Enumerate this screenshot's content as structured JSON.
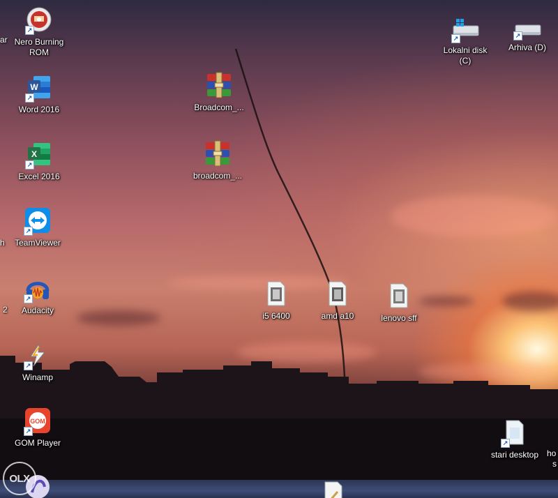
{
  "desktop": {
    "icons": [
      {
        "id": "nero",
        "label": "Nero Burning\nROM",
        "icon": "nero-burning-rom-icon",
        "shortcut": true
      },
      {
        "id": "word",
        "label": "Word 2016",
        "icon": "word-icon",
        "shortcut": true
      },
      {
        "id": "excel",
        "label": "Excel 2016",
        "icon": "excel-icon",
        "shortcut": true
      },
      {
        "id": "teamviewer",
        "label": "TeamViewer",
        "icon": "teamviewer-icon",
        "shortcut": true
      },
      {
        "id": "audacity",
        "label": "Audacity",
        "icon": "audacity-icon",
        "shortcut": true
      },
      {
        "id": "winamp",
        "label": "Winamp",
        "icon": "winamp-icon",
        "shortcut": true
      },
      {
        "id": "gom",
        "label": "GOM Player",
        "icon": "gom-player-icon",
        "shortcut": true
      },
      {
        "id": "broadcom1",
        "label": "Broadcom_...",
        "icon": "winrar-archive-icon",
        "shortcut": false
      },
      {
        "id": "broadcom2",
        "label": "broadcom_...",
        "icon": "winrar-archive-icon",
        "shortcut": false
      },
      {
        "id": "drive_c",
        "label": "Lokalni disk\n(C)",
        "icon": "local-disk-icon",
        "shortcut": true
      },
      {
        "id": "drive_d",
        "label": "Arhiva (D)",
        "icon": "drive-icon",
        "shortcut": true
      },
      {
        "id": "i5",
        "label": "i5 6400",
        "icon": "image-file-icon",
        "shortcut": false
      },
      {
        "id": "amd",
        "label": "amd a10",
        "icon": "image-file-icon",
        "shortcut": false
      },
      {
        "id": "lenovo",
        "label": "lenovo sff",
        "icon": "image-file-icon",
        "shortcut": false
      },
      {
        "id": "stari",
        "label": "stari desktop",
        "icon": "folder-shortcut-icon",
        "shortcut": true
      }
    ],
    "partial_labels": {
      "left_top": "ar",
      "left_mid": "h",
      "left_low": "2",
      "right_bottom_1": "ho",
      "right_bottom_2": "s"
    },
    "watermark": "OLX",
    "colors": {
      "winrar_red": "#c8322c",
      "winrar_blue": "#2c4fb0",
      "winrar_green": "#3a9a3a",
      "word_blue": "#2b579a",
      "excel_green": "#217346",
      "teamviewer_blue": "#0e8ee9",
      "gom_red": "#e8432d",
      "audacity_orange": "#f6a21b"
    }
  }
}
